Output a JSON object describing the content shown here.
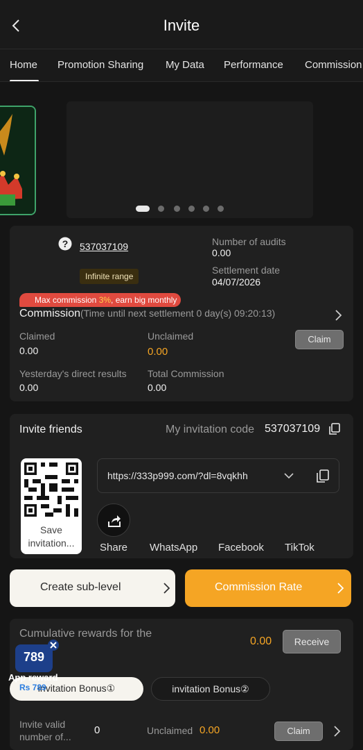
{
  "header": {
    "title": "Invite"
  },
  "tabs": [
    {
      "label": "Home"
    },
    {
      "label": "Promotion Sharing"
    },
    {
      "label": "My Data"
    },
    {
      "label": "Performance"
    },
    {
      "label": "Commission"
    }
  ],
  "banner": {
    "dot_count": 6,
    "active_dot": 0
  },
  "agent": {
    "id": "537037109",
    "range_badge": "Infinite range",
    "audits_label": "Number of audits",
    "audits_value": "0.00",
    "settlement_label": "Settlement date",
    "settlement_value": "04/07/2026",
    "promo_prefix": "Max commission ",
    "promo_highlight": "3%",
    "promo_suffix": ", earn big monthly",
    "commission_title": "Commission",
    "commission_note": "(Time until next settlement  0 day(s) 09:20:13)",
    "claimed_label": "Claimed",
    "claimed_value": "0.00",
    "unclaimed_label": "Unclaimed",
    "unclaimed_value": "0.00",
    "claim_button": "Claim",
    "yesterday_label": "Yesterday's direct results",
    "yesterday_value": "0.00",
    "total_label": "Total Commission",
    "total_value": "0.00"
  },
  "invite": {
    "title": "Invite friends",
    "code_label": "My invitation code",
    "code_value": "537037109",
    "url": "https://333p999.com/?dl=8vqkhh",
    "save_label": "Save invitation...",
    "socials": [
      {
        "label": "Share"
      },
      {
        "label": "WhatsApp"
      },
      {
        "label": "Facebook"
      },
      {
        "label": "TikTok"
      }
    ]
  },
  "actions": {
    "create_sub": "Create sub-level",
    "commission_rate": "Commission Rate"
  },
  "rewards": {
    "title": "Cumulative rewards for the",
    "value": "0.00",
    "receive_button": "Receive",
    "bonus_tab_1": "invitation Bonus①",
    "bonus_tab_2": "invitation Bonus②",
    "valid_label": "Invite valid number of...",
    "valid_value": "0",
    "unclaimed_label": "Unclaimed",
    "unclaimed_value": "0.00",
    "claim_button": "Claim"
  },
  "floating_ad": {
    "logo": "789",
    "label": "App reward",
    "amount": "Rs 789"
  },
  "colors": {
    "accent": "#f5a524",
    "promo_red": "#e04a3f",
    "background": "#151515",
    "card": "#202020"
  }
}
